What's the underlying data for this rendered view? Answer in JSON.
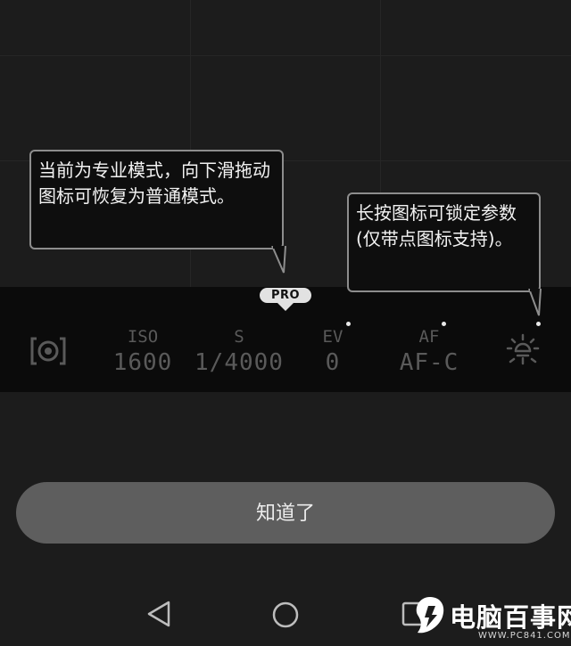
{
  "tooltips": {
    "pro_hint": "当前为专业模式，向下滑拖动图标可恢复为普通模式。",
    "lock_hint": "长按图标可锁定参数 (仅带点图标支持)。"
  },
  "mode_badge": "PRO",
  "params": {
    "iso": {
      "label": "ISO",
      "value": "1600"
    },
    "shutter": {
      "label": "S",
      "value": "1/4000"
    },
    "ev": {
      "label": "EV",
      "value": "0"
    },
    "af": {
      "label": "AF",
      "value": "AF-C"
    }
  },
  "icons": {
    "metering": "metering-mode-icon",
    "white_balance": "light-bulb-icon",
    "back": "triangle-back-icon",
    "home": "circle-home-icon",
    "recent": "square-recent-icon"
  },
  "got_it_button": "知道了",
  "watermark": {
    "brand": "电脑百事网",
    "url": "WWW.PC841.COM"
  },
  "colors": {
    "background": "#1c1c1c",
    "control_bar": "#0b0b0b",
    "param_text": "#5a5a5a",
    "tooltip_border": "#8d8d8d",
    "button": "#5e5e5e"
  }
}
